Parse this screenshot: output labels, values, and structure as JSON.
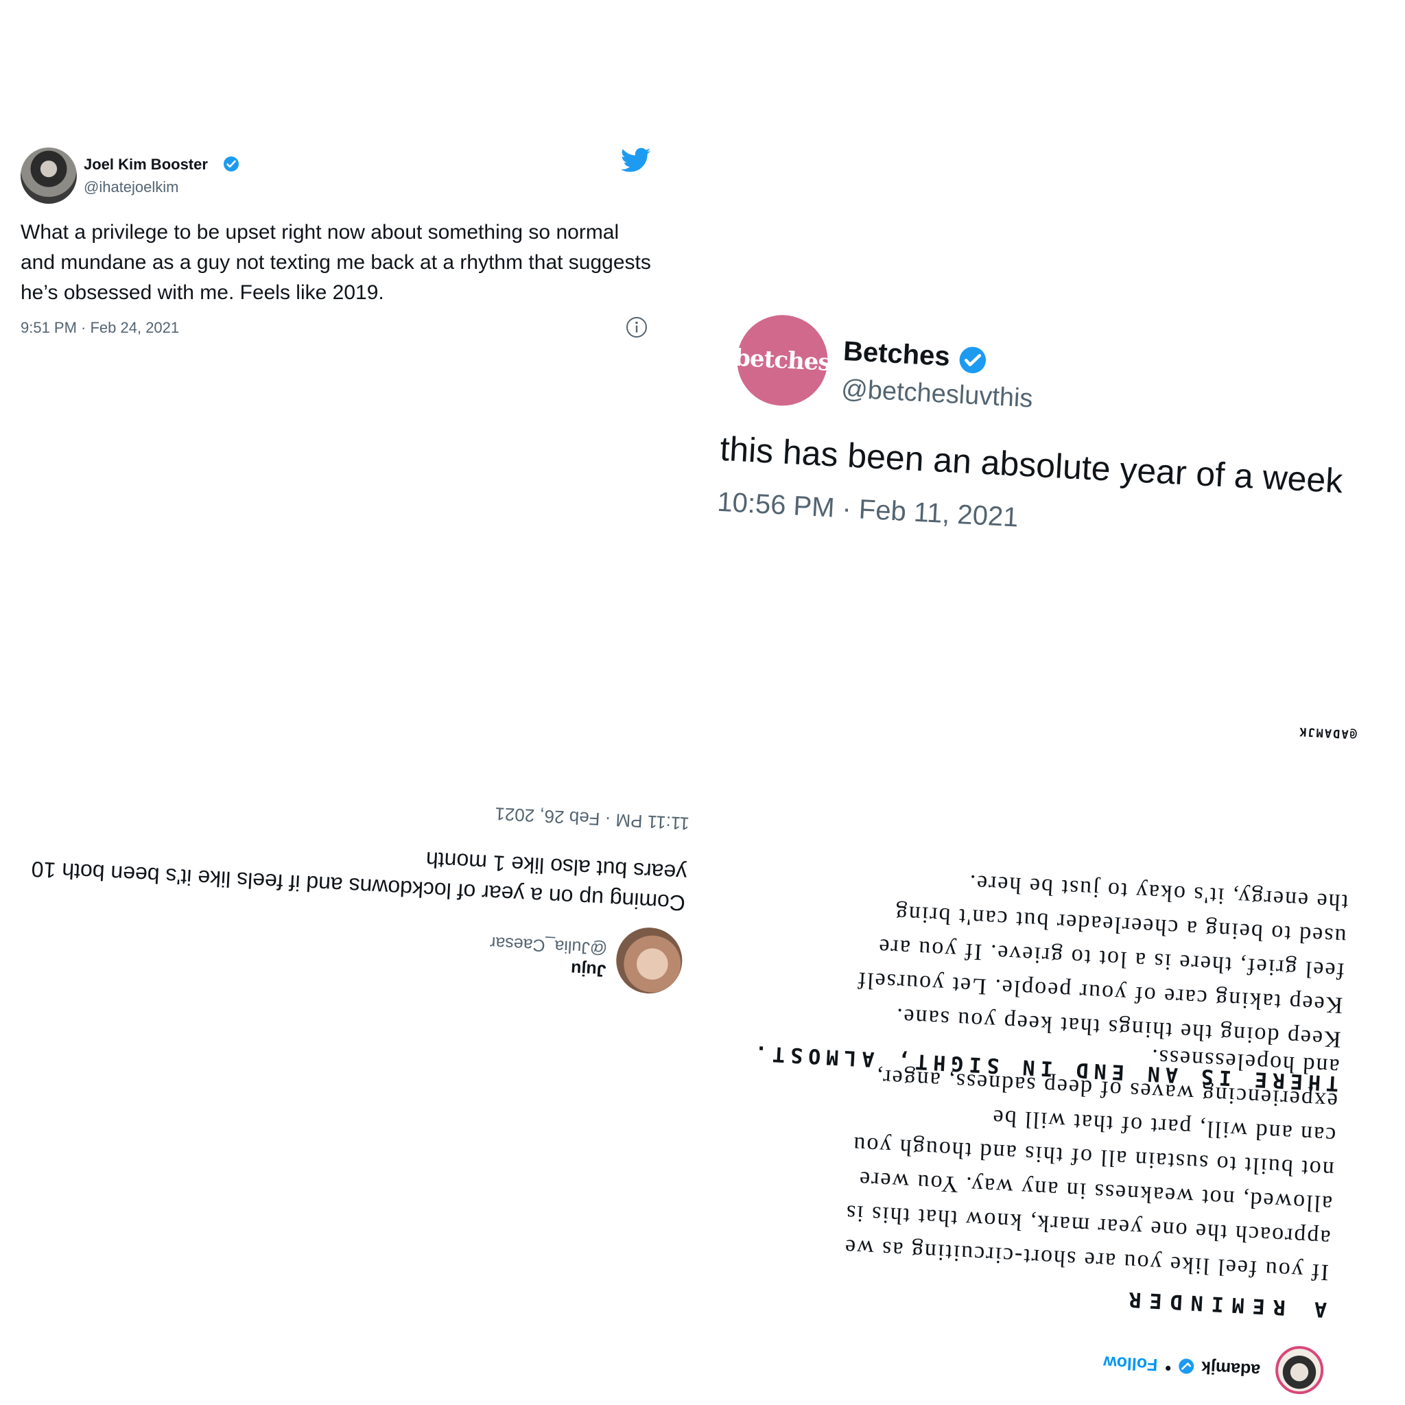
{
  "tweet_joel": {
    "name": "Joel Kim Booster",
    "handle": "@ihatejoelkim",
    "text": "What a privilege to be upset right now about something so normal and mundane as a guy not texting me back at a rhythm that suggests he’s obsessed with me. Feels like 2019.",
    "timestamp": "9:51 PM · Feb 24, 2021"
  },
  "tweet_betches": {
    "avatar_text": "betches",
    "name": "Betches",
    "handle": "@betchesluvthis",
    "text": "this has been an absolute year of a week",
    "timestamp": "10:56 PM · Feb 11, 2021"
  },
  "tweet_juju": {
    "name": "Juju",
    "handle": "@Julia_Caesar",
    "text": "Coming up on a year of lockdowns and if feels like it's been both 10 years but also like 1 month",
    "timestamp": "11:11 PM · Feb 26, 2021"
  },
  "ig_post": {
    "username": "adamjk",
    "separator": "•",
    "follow_label": "Follow",
    "heading1": "A REMINDER",
    "paragraph1": "If you feel like you are short-circuiting as we approach the one year mark, know that this is allowed, not weakness in any way. You were not built to sustain all of this and though you can and will, part of that will be experiencing waves of deep sadness, anger, and hopelessness.",
    "heading2": "THERE IS AN END IN SIGHT, ALMOST.",
    "paragraph2": "Keep doing the things that keep you sane. Keep taking care of your people. Let yourself feel grief, there is a lot to grieve. If you are used to being a cheerleader but can't bring the energy, it's okay to just be here.",
    "credit": "@ADAMJK"
  },
  "colors": {
    "twitter_blue": "#1d9bf0",
    "betches_pink": "#d1698d",
    "instagram_follow": "#0095f6",
    "muted_text": "#536471"
  },
  "icons": [
    "twitter-bird-icon",
    "verified-badge-icon",
    "info-icon"
  ]
}
